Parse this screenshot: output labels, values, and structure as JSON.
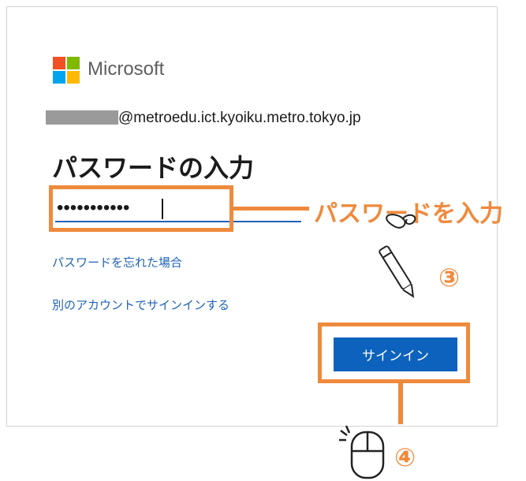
{
  "brand": {
    "name": "Microsoft",
    "colors": [
      "#f25022",
      "#7fba00",
      "#00a4ef",
      "#ffb900"
    ]
  },
  "account": {
    "email_suffix": "@metroedu.ict.kyoiku.metro.tokyo.jp"
  },
  "page": {
    "title": "パスワードの入力"
  },
  "password": {
    "masked_value": "•••••••••••"
  },
  "links": {
    "forgot": "パスワードを忘れた場合",
    "other_account": "別のアカウントでサインインする"
  },
  "signin": {
    "label": "サインイン"
  },
  "annotations": {
    "callout": "パスワードを入力",
    "step3": "③",
    "step4": "④",
    "accent_color": "#ef8a3d"
  }
}
